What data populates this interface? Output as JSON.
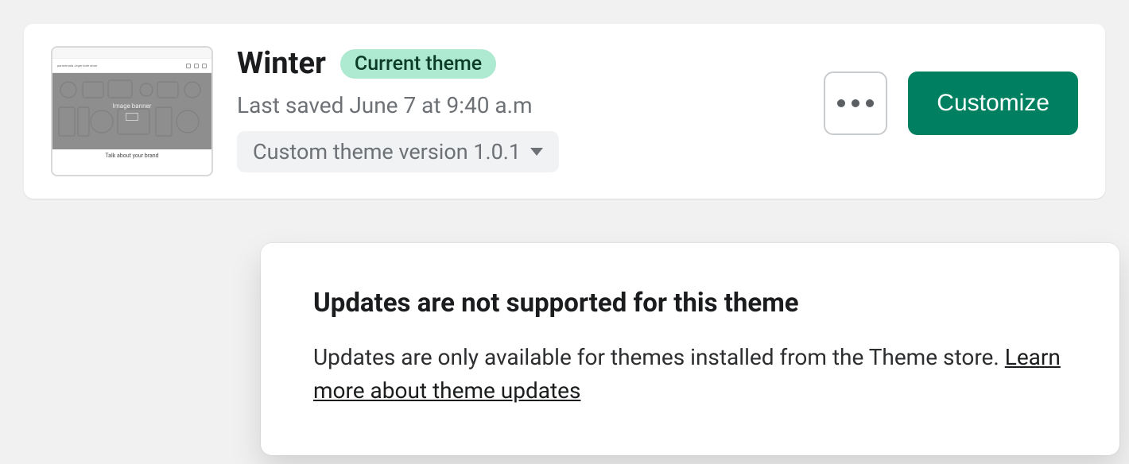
{
  "theme": {
    "name": "Winter",
    "badge": "Current theme",
    "last_saved": "Last saved June 7 at 9:40 a.m",
    "version_label": "Custom theme version 1.0.1"
  },
  "thumbnail": {
    "hero_label": "Image banner",
    "caption_title": "Talk about your brand",
    "brand_text": "parmersola Jeger bote store"
  },
  "actions": {
    "customize": "Customize"
  },
  "popover": {
    "title": "Updates are not supported for this theme",
    "body": "Updates are only available for themes installed from the Theme store. ",
    "link": "Learn more about theme updates"
  }
}
